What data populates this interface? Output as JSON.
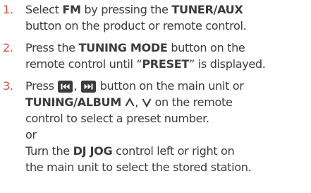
{
  "colors": {
    "number": "#d4513c",
    "text": "#3c3c3c",
    "icon": "#3c3c3c"
  },
  "steps": [
    {
      "num": "1.",
      "l1": [
        "Select ",
        "FM",
        " by pressing the ",
        "TUNER/AUX"
      ],
      "l2": "button on the product or remote control."
    },
    {
      "num": "2.",
      "l1": [
        "Press the ",
        "TUNING MODE",
        " button on the"
      ],
      "l2": [
        "remote control until ",
        "“",
        "PRESET",
        "”",
        " is displayed."
      ]
    },
    {
      "num": "3.",
      "l1": [
        "Press ",
        ", ",
        " button on the main unit or"
      ],
      "l2": [
        "TUNING/ALBUM ",
        ", ",
        " on the remote"
      ],
      "l3": "control to select a preset number.",
      "l4": "or",
      "l5": [
        "Turn the ",
        "DJ JOG",
        " control left or right on"
      ],
      "l6": "the main unit to select the stored station."
    }
  ],
  "icons": [
    "skip-back-icon",
    "skip-forward-icon",
    "chevron-up-icon",
    "chevron-down-icon"
  ]
}
